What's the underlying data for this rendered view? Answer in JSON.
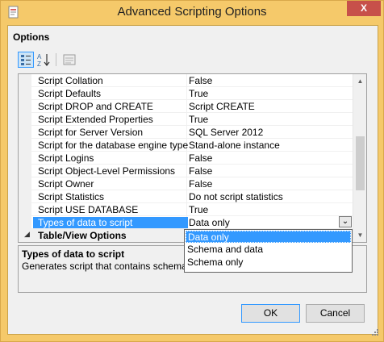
{
  "window": {
    "title": "Advanced Scripting Options",
    "close_glyph": "X"
  },
  "options": {
    "heading": "Options"
  },
  "toolbar": {
    "categorized_icon": "categorized-icon",
    "alphabetical_icon": "sort-az-icon",
    "property_pages_icon": "property-pages-icon"
  },
  "grid": {
    "rows": [
      {
        "name": "Script Collation",
        "value": "False"
      },
      {
        "name": "Script Defaults",
        "value": "True"
      },
      {
        "name": "Script DROP and CREATE",
        "value": "Script CREATE"
      },
      {
        "name": "Script Extended Properties",
        "value": "True"
      },
      {
        "name": "Script for Server Version",
        "value": "SQL Server 2012"
      },
      {
        "name": "Script for the database engine type",
        "value": "Stand-alone instance"
      },
      {
        "name": "Script Logins",
        "value": "False"
      },
      {
        "name": "Script Object-Level Permissions",
        "value": "False"
      },
      {
        "name": "Script Owner",
        "value": "False"
      },
      {
        "name": "Script Statistics",
        "value": "Do not script statistics"
      },
      {
        "name": "Script USE DATABASE",
        "value": "True"
      },
      {
        "name": "Types of data to script",
        "value": "Data only"
      }
    ],
    "category": {
      "label": "Table/View Options",
      "expander": "◢"
    },
    "dropdown_glyph": "⌄"
  },
  "dropdown": {
    "options": [
      "Data only",
      "Schema and data",
      "Schema only"
    ],
    "selected": 0
  },
  "description": {
    "title": "Types of data to script",
    "text": "Generates script that contains schema only"
  },
  "buttons": {
    "ok": "OK",
    "cancel": "Cancel"
  },
  "colors": {
    "accent": "#3399ff",
    "frame": "#f5c96a",
    "close": "#c7504a"
  }
}
